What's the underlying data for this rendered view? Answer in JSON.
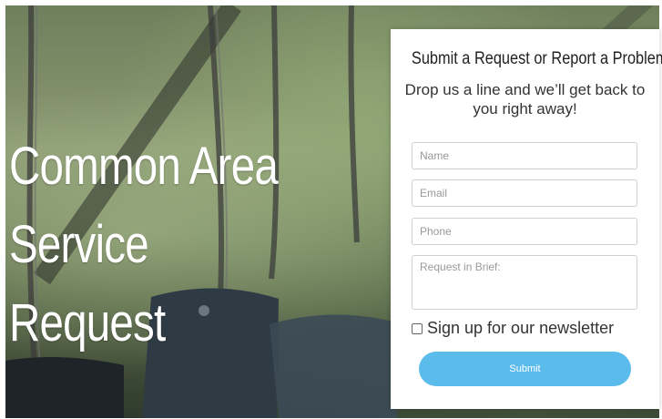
{
  "hero": {
    "title_lines": [
      "Common Area",
      "Service",
      "Request"
    ]
  },
  "form": {
    "heading": "Submit a Request or Report a Problem",
    "subheading": "Drop us a line and we’ll get back to you right away!",
    "fields": {
      "name_placeholder": "Name",
      "email_placeholder": "Email",
      "phone_placeholder": "Phone",
      "request_placeholder": "Request in Brief:"
    },
    "newsletter_label": "Sign up for our newsletter",
    "newsletter_checked": false,
    "submit_label": "Submit"
  },
  "colors": {
    "submit_button": "#5bbcec",
    "hero_text": "#ffffff"
  }
}
